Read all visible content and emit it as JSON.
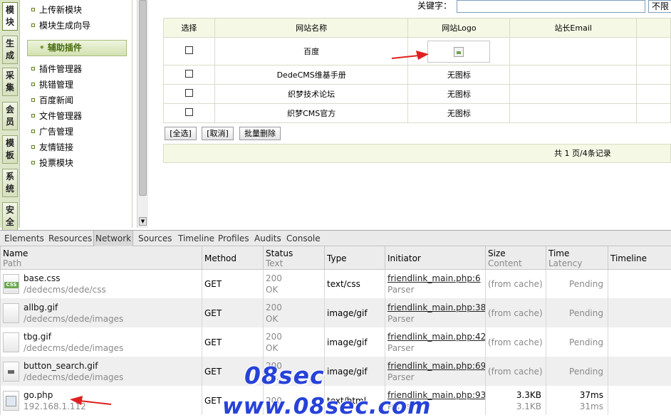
{
  "left_tabs": [
    "模块",
    "生成",
    "采集",
    "会员",
    "模板",
    "系统",
    "安全"
  ],
  "menu": {
    "top_items": [
      "上传新模块",
      "模块生成向导"
    ],
    "section_header": "辅助插件",
    "items": [
      "插件管理器",
      "挑错管理",
      "百度新闻",
      "文件管理器",
      "广告管理",
      "友情链接",
      "投票模块"
    ]
  },
  "search": {
    "keyword_label": "关键字：",
    "keyword_value": "",
    "select_value": "不限"
  },
  "table": {
    "headers": [
      "选择",
      "网站名称",
      "网站Logo",
      "站长Email"
    ],
    "rows": [
      {
        "name": "百度",
        "logo": "",
        "email": ""
      },
      {
        "name": "DedeCMS维基手册",
        "logo": "无图标",
        "email": ""
      },
      {
        "name": "织梦技术论坛",
        "logo": "无图标",
        "email": ""
      },
      {
        "name": "织梦CMS官方",
        "logo": "无图标",
        "email": ""
      }
    ],
    "buttons": [
      "[全选]",
      "[取消]",
      "批量删除"
    ],
    "pagination": "共 1 页/4条记录"
  },
  "devtools": {
    "tabs": [
      "Elements",
      "Resources",
      "Network",
      "Sources",
      "Timeline",
      "Profiles",
      "Audits",
      "Console"
    ],
    "active_tab": "Network",
    "columns": [
      {
        "main": "Name",
        "sub": "Path"
      },
      {
        "main": "Method",
        "sub": ""
      },
      {
        "main": "Status",
        "sub": "Text"
      },
      {
        "main": "Type",
        "sub": ""
      },
      {
        "main": "Initiator",
        "sub": ""
      },
      {
        "main": "Size",
        "sub": "Content"
      },
      {
        "main": "Time",
        "sub": "Latency"
      },
      {
        "main": "Timeline",
        "sub": ""
      }
    ],
    "requests": [
      {
        "name": "base.css",
        "path": "/dedecms/dede/css",
        "method": "GET",
        "status": "200",
        "status_text": "OK",
        "type": "text/css",
        "initiator": "friendlink_main.php:6",
        "initiator_sub": "Parser",
        "size": "(from cache)",
        "content": "",
        "time": "Pending",
        "latency": "",
        "icon": "css-file-icon"
      },
      {
        "name": "allbg.gif",
        "path": "/dedecms/dede/images",
        "method": "GET",
        "status": "200",
        "status_text": "OK",
        "type": "image/gif",
        "initiator": "friendlink_main.php:38",
        "initiator_sub": "Parser",
        "size": "(from cache)",
        "content": "",
        "time": "Pending",
        "latency": "",
        "icon": "image-file-icon"
      },
      {
        "name": "tbg.gif",
        "path": "/dedecms/dede/images",
        "method": "GET",
        "status": "200",
        "status_text": "OK",
        "type": "image/gif",
        "initiator": "friendlink_main.php:42",
        "initiator_sub": "Parser",
        "size": "(from cache)",
        "content": "",
        "time": "Pending",
        "latency": "",
        "icon": "image-file-icon"
      },
      {
        "name": "button_search.gif",
        "path": "/dedecms/dede/images",
        "method": "GET",
        "status": "200",
        "status_text": "OK",
        "type": "image/gif",
        "initiator": "friendlink_main.php:69",
        "initiator_sub": "Parser",
        "size": "(from cache)",
        "content": "",
        "time": "Pending",
        "latency": "",
        "icon": "image-file-icon"
      },
      {
        "name": "go.php",
        "path": "192.168.1.112",
        "method": "GET",
        "status": "200",
        "status_text": "",
        "type": "text/html",
        "initiator": "friendlink_main.php:93",
        "initiator_sub": "Parser",
        "size": "3.3KB",
        "content": "3.1KB",
        "time": "37ms",
        "latency": "31ms",
        "icon": "php-file-icon"
      }
    ]
  },
  "watermark": {
    "line1": "08sec",
    "line2": "www.08sec.com"
  },
  "colors": {
    "accent_green": "#466b0e",
    "arrow_red": "#e02020",
    "watermark_blue": "#2742d9"
  }
}
